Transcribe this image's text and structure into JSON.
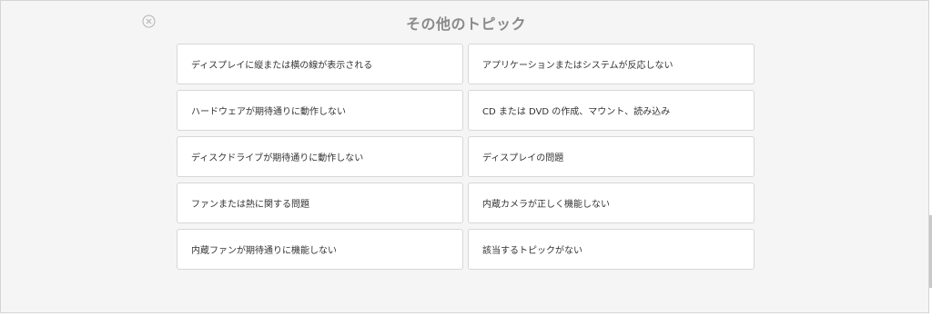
{
  "header": {
    "title": "その他のトピック",
    "close_icon": "close-circle-x-icon"
  },
  "topics": [
    {
      "label": "ディスプレイに縦または横の線が表示される"
    },
    {
      "label": "アプリケーションまたはシステムが反応しない"
    },
    {
      "label": "ハードウェアが期待通りに動作しない"
    },
    {
      "label": "CD または DVD の作成、マウント、読み込み"
    },
    {
      "label": "ディスクドライブが期待通りに動作しない"
    },
    {
      "label": "ディスプレイの問題"
    },
    {
      "label": "ファンまたは熱に関する問題"
    },
    {
      "label": "内蔵カメラが正しく機能しない"
    },
    {
      "label": "内蔵ファンが期待通りに機能しない"
    },
    {
      "label": "該当するトピックがない"
    }
  ],
  "colors": {
    "panel_background": "#f5f5f5",
    "card_background": "#ffffff",
    "card_border": "#d7d7d7",
    "title_text": "#8a8a8a",
    "body_text": "#333333"
  }
}
